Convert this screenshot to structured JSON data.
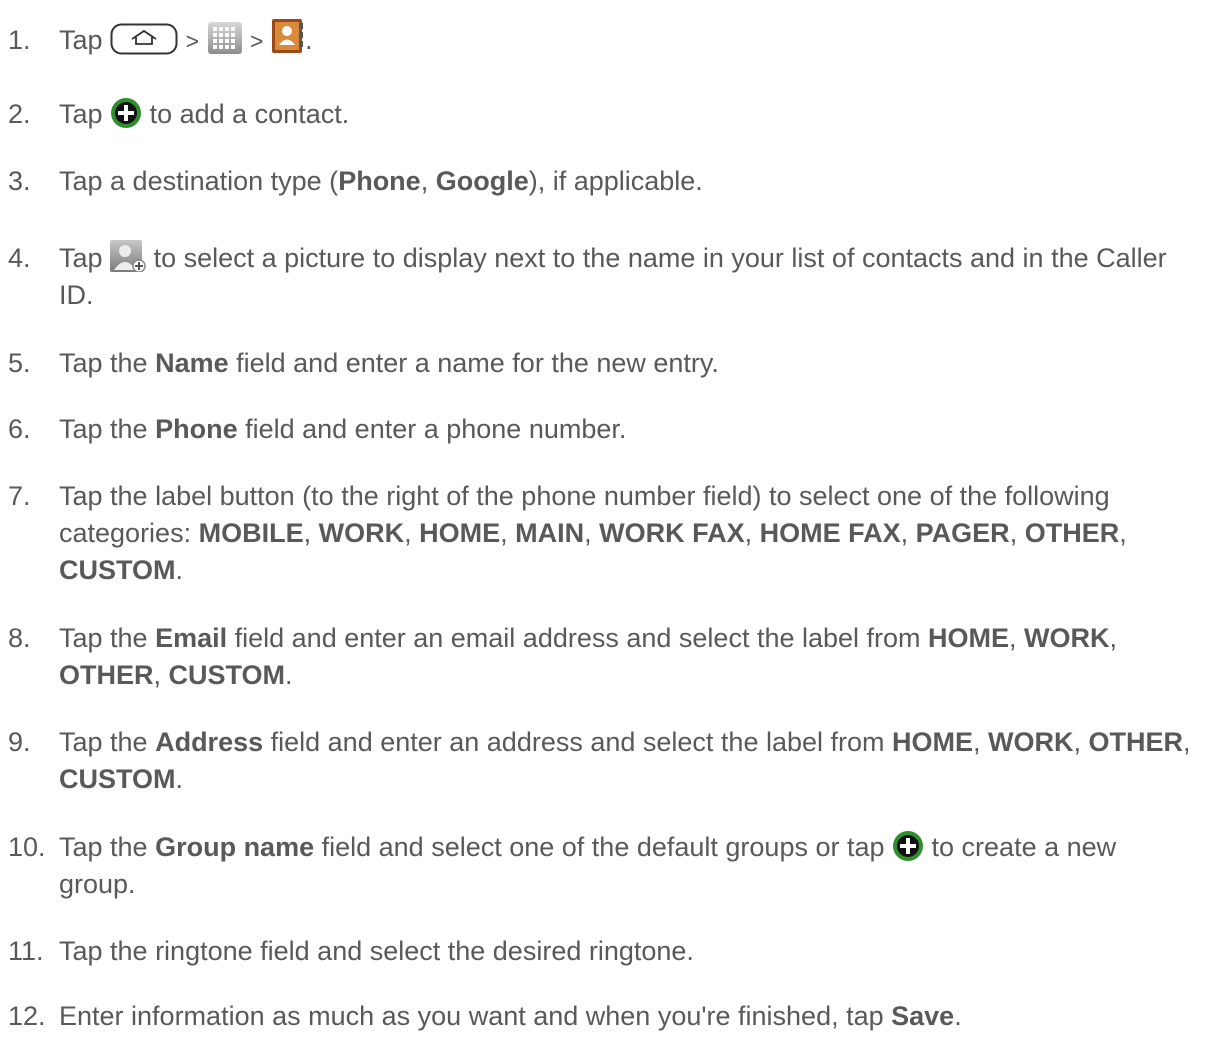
{
  "steps": [
    {
      "num": "1.",
      "tap": "Tap",
      "sep1": ">",
      "sep2": ">",
      "end": ".",
      "icons": [
        "home-key-icon",
        "apps-grid-icon",
        "contacts-app-icon"
      ]
    },
    {
      "num": "2.",
      "tap": "Tap",
      "rest": "to add a contact.",
      "icons": [
        "add-circle-icon"
      ]
    },
    {
      "num": "3.",
      "t1": "Tap a destination type (",
      "b1": "Phone",
      "t2": ", ",
      "b2": "Google",
      "t3": "), if applicable."
    },
    {
      "num": "4.",
      "tap": "Tap",
      "rest": "to select a picture to display next to the name in your list of contacts and in the Caller ID.",
      "icons": [
        "contact-photo-icon"
      ]
    },
    {
      "num": "5.",
      "t1": "Tap the ",
      "b1": "Name",
      "t2": " field and enter a name for the new entry."
    },
    {
      "num": "6.",
      "t1": "Tap the ",
      "b1": "Phone",
      "t2": " field and enter a phone number."
    },
    {
      "num": "7.",
      "t1": "Tap the label button (to the right of the phone number field) to select one of the following categories: ",
      "labels": [
        "MOBILE",
        "WORK",
        "HOME",
        "MAIN",
        "WORK FAX",
        "HOME FAX",
        "PAGER",
        "OTHER",
        "CUSTOM"
      ]
    },
    {
      "num": "8.",
      "t1": "Tap the ",
      "b1": "Email",
      "t2": " field and enter an email address and select the label from ",
      "labels": [
        "HOME",
        "WORK",
        "OTHER",
        "CUSTOM"
      ]
    },
    {
      "num": "9.",
      "t1": "Tap the ",
      "b1": "Address",
      "t2": " field and enter an address and select the label from ",
      "labels": [
        "HOME",
        "WORK",
        "OTHER",
        "CUSTOM"
      ]
    },
    {
      "num": "10.",
      "t1": "Tap the ",
      "b1": "Group name",
      "t2": " field and select one of the default groups or tap",
      "t3": "to create a new group.",
      "icons": [
        "add-circle-icon"
      ]
    },
    {
      "num": "11.",
      "text": "Tap the ringtone field and select the desired ringtone."
    },
    {
      "num": "12.",
      "t1": "Enter information as much as you want and when you're finished, tap ",
      "b1": "Save",
      "t2": "."
    }
  ],
  "colors": {
    "text": "#595959",
    "icon_green": "#2f8f2f",
    "icon_gray": "#8a8a8a"
  }
}
